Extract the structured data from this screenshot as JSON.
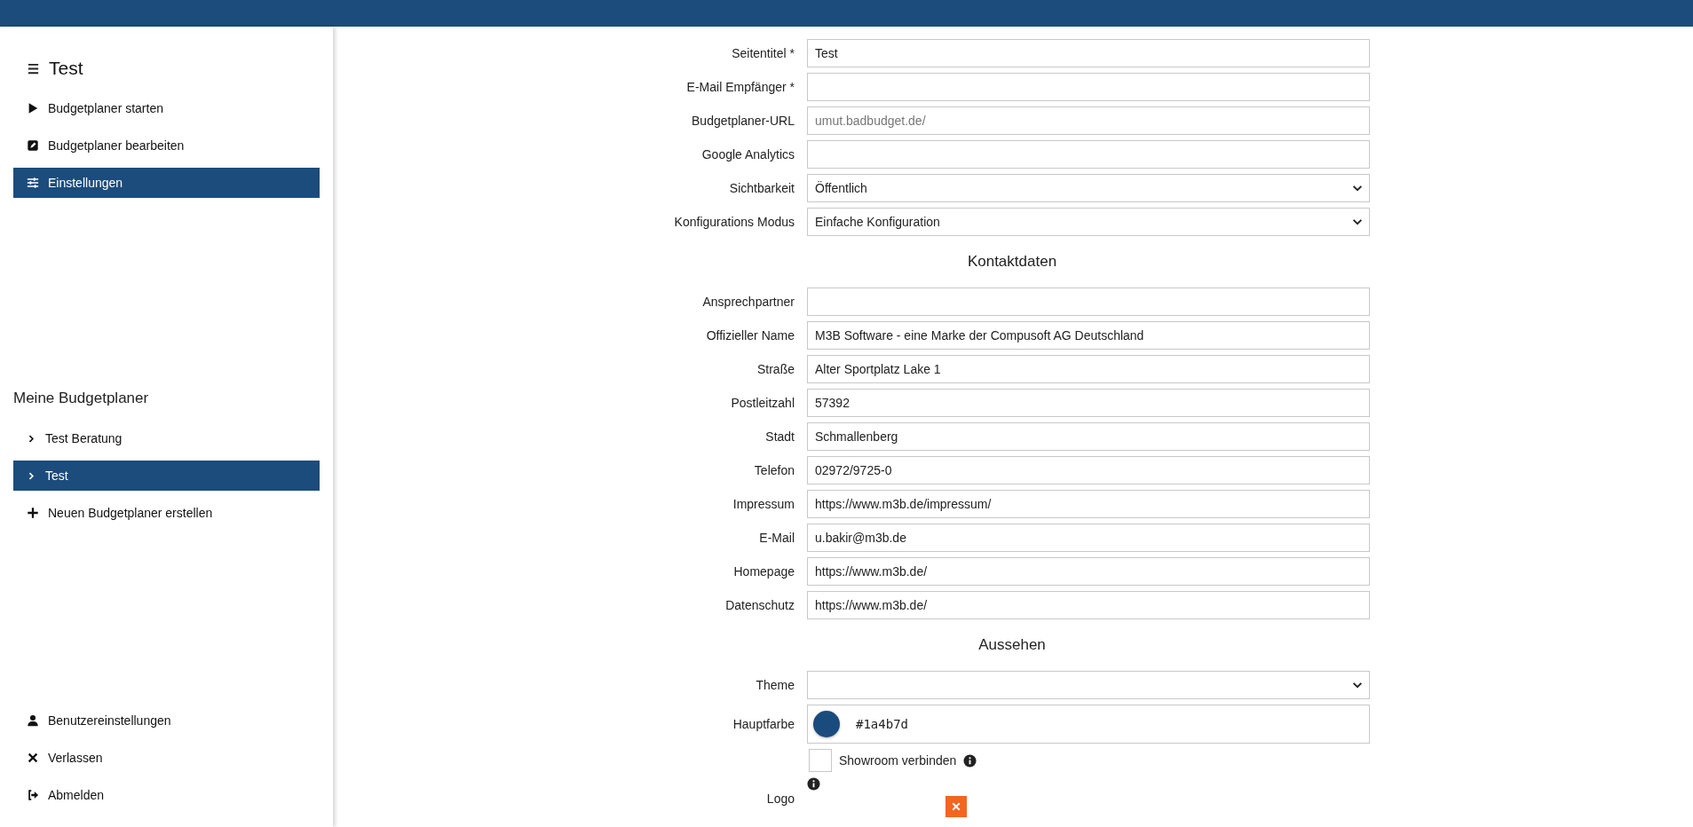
{
  "sidebar": {
    "title": "Test",
    "nav": [
      {
        "label": "Budgetplaner starten",
        "selected": false
      },
      {
        "label": "Budgetplaner bearbeiten",
        "selected": false
      },
      {
        "label": "Einstellungen",
        "selected": true
      }
    ],
    "planners_heading": "Meine Budgetplaner",
    "planners": [
      {
        "label": "Test Beratung",
        "selected": false
      },
      {
        "label": "Test",
        "selected": true
      }
    ],
    "create_planner": "Neuen Budgetplaner erstellen",
    "account": [
      {
        "label": "Benutzereinstellungen"
      },
      {
        "label": "Verlassen"
      },
      {
        "label": "Abmelden"
      }
    ]
  },
  "form": {
    "general": [
      {
        "label": "Seitentitel *",
        "kind": "text",
        "value": "Test"
      },
      {
        "label": "E-Mail Empfänger *",
        "kind": "text"
      },
      {
        "label": "Budgetplaner-URL",
        "kind": "text",
        "placeholder": "umut.badbudget.de/"
      },
      {
        "label": "Google Analytics",
        "kind": "text"
      },
      {
        "label": "Sichtbarkeit",
        "kind": "select",
        "value": "Öffentlich"
      },
      {
        "label": "Konfigurations Modus",
        "kind": "select",
        "value": "Einfache Konfiguration"
      }
    ],
    "contact": {
      "heading": "Kontaktdaten",
      "fields": [
        {
          "label": "Ansprechpartner",
          "kind": "text"
        },
        {
          "label": "Offizieller Name",
          "kind": "text",
          "value": "M3B Software - eine Marke der Compusoft AG Deutschland"
        },
        {
          "label": "Straße",
          "kind": "text",
          "value": "Alter Sportplatz Lake 1"
        },
        {
          "label": "Postleitzahl",
          "kind": "text",
          "value": "57392"
        },
        {
          "label": "Stadt",
          "kind": "text",
          "value": "Schmallenberg"
        },
        {
          "label": "Telefon",
          "kind": "text",
          "value": "02972/9725-0"
        },
        {
          "label": "Impressum",
          "kind": "text",
          "value": "https://www.m3b.de/impressum/"
        },
        {
          "label": "E-Mail",
          "kind": "text",
          "value": "u.bakir@m3b.de"
        },
        {
          "label": "Homepage",
          "kind": "text",
          "value": "https://www.m3b.de/"
        },
        {
          "label": "Datenschutz",
          "kind": "text",
          "value": "https://www.m3b.de/"
        }
      ]
    },
    "appearance": {
      "heading": "Aussehen",
      "fields": [
        {
          "label": "Theme",
          "kind": "select"
        }
      ],
      "main_color": {
        "label": "Hauptfarbe",
        "value": "#1a4b7d",
        "color": "#1a4b7d"
      },
      "showroom": {
        "label": "Showroom verbinden",
        "checked": false
      },
      "logo": {
        "label": "Logo"
      }
    }
  }
}
